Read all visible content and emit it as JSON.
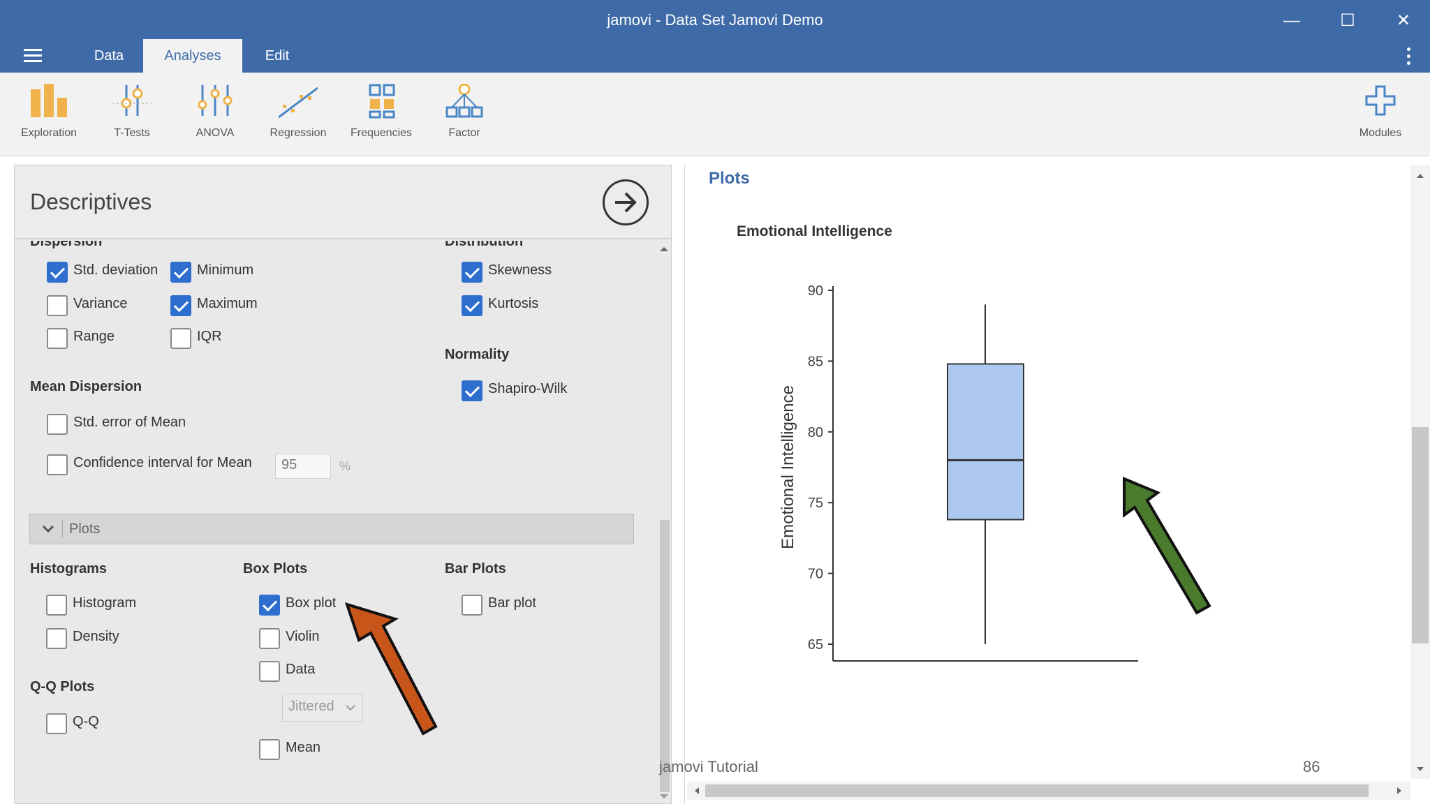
{
  "window": {
    "title": "jamovi - Data Set Jamovi Demo",
    "minimize_glyph": "—",
    "maximize_glyph": "☐",
    "close_glyph": "✕"
  },
  "menu": {
    "tabs": [
      "Data",
      "Analyses",
      "Edit"
    ],
    "active_tab": "Analyses"
  },
  "ribbon": {
    "buttons": [
      {
        "label": "Exploration",
        "icon": "exploration-icon"
      },
      {
        "label": "T-Tests",
        "icon": "t-tests-icon"
      },
      {
        "label": "ANOVA",
        "icon": "anova-icon"
      },
      {
        "label": "Regression",
        "icon": "regression-icon"
      },
      {
        "label": "Frequencies",
        "icon": "frequencies-icon"
      },
      {
        "label": "Factor",
        "icon": "factor-icon"
      }
    ],
    "modules_label": "Modules",
    "accent": "#f0b24a",
    "blue": "#4a86c5"
  },
  "options": {
    "title": "Descriptives",
    "dispersion_heading": "Dispersion",
    "distribution_heading": "Distribution",
    "dispersion": {
      "std_deviation": {
        "label": "Std. deviation",
        "checked": true
      },
      "minimum": {
        "label": "Minimum",
        "checked": true
      },
      "variance": {
        "label": "Variance",
        "checked": false
      },
      "maximum": {
        "label": "Maximum",
        "checked": true
      },
      "range": {
        "label": "Range",
        "checked": false
      },
      "iqr": {
        "label": "IQR",
        "checked": false
      }
    },
    "distribution": {
      "skewness": {
        "label": "Skewness",
        "checked": true
      },
      "kurtosis": {
        "label": "Kurtosis",
        "checked": true
      }
    },
    "normality_heading": "Normality",
    "shapiro_wilk": {
      "label": "Shapiro-Wilk",
      "checked": true
    },
    "mean_dispersion_heading": "Mean Dispersion",
    "std_error_mean": {
      "label": "Std. error of Mean",
      "checked": false
    },
    "ci_mean": {
      "label": "Confidence interval for Mean",
      "checked": false,
      "value": "95",
      "unit": "%"
    },
    "plots_section_label": "Plots",
    "histograms_heading": "Histograms",
    "histogram": {
      "label": "Histogram",
      "checked": false
    },
    "density": {
      "label": "Density",
      "checked": false
    },
    "qq_heading": "Q-Q Plots",
    "qq": {
      "label": "Q-Q",
      "checked": false
    },
    "box_plots_heading": "Box Plots",
    "box_plot": {
      "label": "Box plot",
      "checked": true
    },
    "violin": {
      "label": "Violin",
      "checked": false
    },
    "data": {
      "label": "Data",
      "checked": false
    },
    "data_mode": "Jittered",
    "mean": {
      "label": "Mean",
      "checked": false
    },
    "bar_plots_heading": "Bar Plots",
    "bar_plot": {
      "label": "Bar plot",
      "checked": false
    },
    "checkbox_color": "#2e6ecf"
  },
  "results": {
    "heading": "Plots",
    "plot_title": "Emotional Intelligence"
  },
  "chart_data": {
    "type": "box",
    "title": "Emotional Intelligence",
    "ylabel": "Emotional Intelligence",
    "xlabel": "",
    "ylim": [
      64,
      91
    ],
    "yticks": [
      65,
      70,
      75,
      80,
      85,
      90
    ],
    "box": {
      "whisker_low": 65,
      "q1": 73.8,
      "median": 78,
      "q3": 84.8,
      "whisker_high": 89
    },
    "fill": "#aec9ef",
    "stroke": "#333333"
  },
  "annotations": {
    "orange_arrow_color": "#c8561a",
    "green_arrow_color": "#4a7a2c"
  },
  "footer": {
    "left": "jamovi Tutorial",
    "right": "86"
  }
}
